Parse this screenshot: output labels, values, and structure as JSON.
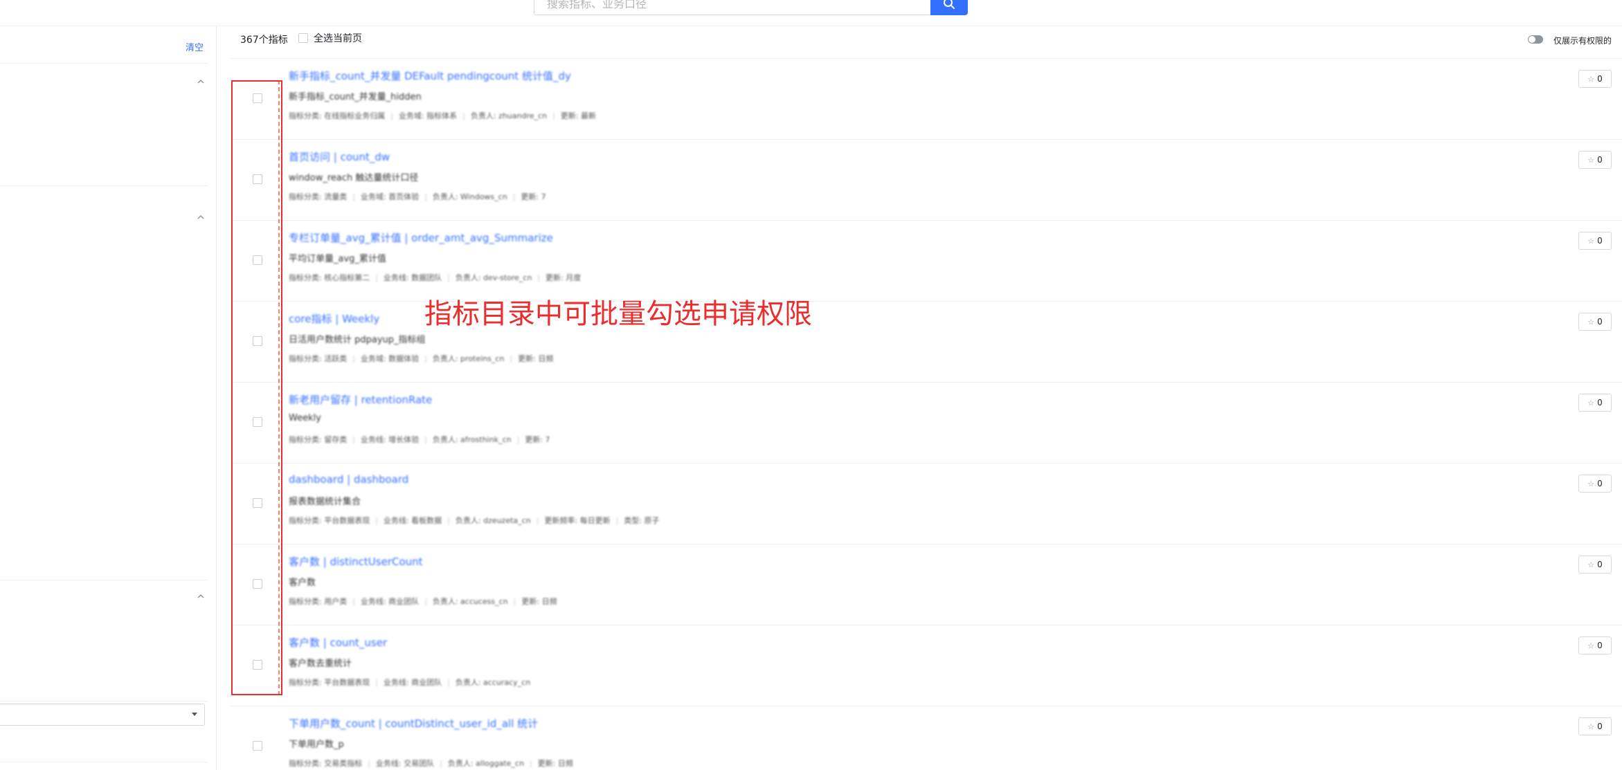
{
  "search": {
    "placeholder": "搜索指标、业务口径"
  },
  "filter_panel": {
    "clear_label": "清空",
    "select_value": ""
  },
  "results": {
    "count_label": "367个指标",
    "select_page_label": "全选当前页",
    "only_permitted_label": "仅展示有权限的"
  },
  "items": [
    {
      "title": "新手指标_count_并发量 DEFault pendingcount 统计值_dy",
      "desc": "新手指标_count_并发量_hidden",
      "meta": [
        "指标分类: 在线指标业务归属",
        "业务域: 指标体系",
        "负责人: zhuandre_cn",
        "更新: 最新"
      ],
      "likes": "0"
    },
    {
      "title": "首页访问 | count_dw",
      "desc": "window_reach 触达量统计口径",
      "meta": [
        "指标分类: 流量类",
        "业务域: 首页体验",
        "负责人: Windows_cn",
        "更新: 7"
      ],
      "likes": "0"
    },
    {
      "title": "专栏订单量_avg_累计值 | order_amt_avg_Summarize",
      "desc": "平均订单量_avg_累计值",
      "meta": [
        "指标分类: 核心指标第二",
        "业务线: 数据团队",
        "负责人: dev-store_cn",
        "更新: 月度"
      ],
      "likes": "0"
    },
    {
      "title": "core指标 | Weekly",
      "desc": "日活用户数统计 pdpayup_指标组",
      "meta": [
        "指标分类: 活跃类",
        "业务域: 数据体验",
        "负责人: proteins_cn",
        "更新: 日频"
      ],
      "likes": "0"
    },
    {
      "title": "新老用户留存 | retentionRate",
      "desc": "Weekly",
      "meta": [
        "指标分类: 留存类",
        "业务线: 增长体验",
        "负责人: afrosthink_cn",
        "更新: 7"
      ],
      "likes": "0"
    },
    {
      "title": "dashboard | dashboard",
      "desc": "报表数据统计集合",
      "meta": [
        "指标分类: 平台数据表现",
        "业务线: 看板数据",
        "负责人: dzeuzeta_cn",
        "更新频率: 每日更新",
        "类型: 原子"
      ],
      "likes": "0"
    },
    {
      "title": "客户数 | distinctUserCount",
      "desc": "客户数",
      "meta": [
        "指标分类: 用户类",
        "业务线: 商业团队",
        "负责人: accucess_cn",
        "更新: 日频"
      ],
      "likes": "0"
    },
    {
      "title": "客户数 | count_user",
      "desc": "客户数去重统计",
      "meta": [
        "指标分类: 平台数据表现",
        "业务线: 商业团队",
        "负责人: accuracy_cn"
      ],
      "likes": "0"
    },
    {
      "title": "下单用户数_count | countDistinct_user_id_all 统计",
      "desc": "下单用户数_p",
      "meta": [
        "指标分类: 交易类指标",
        "业务线: 交易团队",
        "负责人: alloggate_cn",
        "更新: 日频"
      ],
      "likes": "0"
    }
  ],
  "annotation": {
    "text": "指标目录中可批量勾选申请权限"
  },
  "colors": {
    "accent": "#3370ff",
    "annotation": "#ea2d2d"
  }
}
